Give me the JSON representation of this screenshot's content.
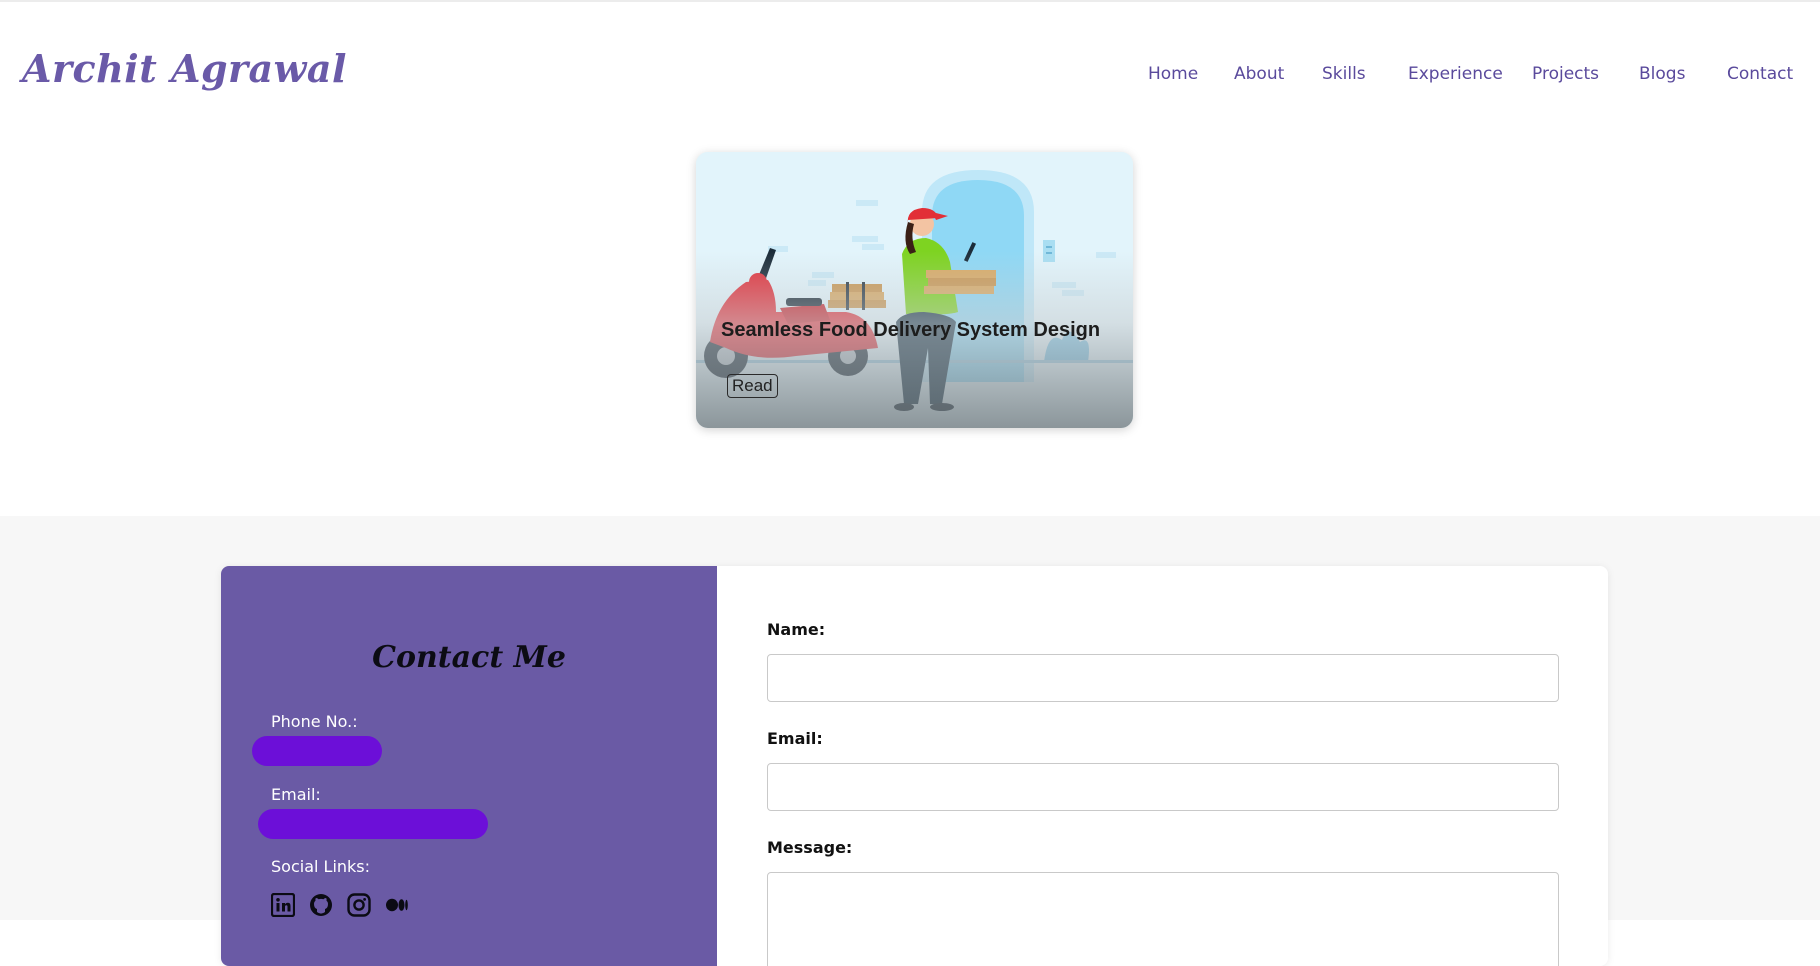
{
  "header": {
    "logo": "Archit Agrawal",
    "nav": [
      "Home",
      "About",
      "Skills",
      "Experience",
      "Projects",
      "Blogs",
      "Contact"
    ]
  },
  "blog": {
    "title": "Seamless Food Delivery System Design",
    "read_label": "Read",
    "image_icon": "food-delivery-illustration"
  },
  "contact": {
    "heading": "Contact Me",
    "phone_label": "Phone No.:",
    "email_label": "Email:",
    "social_label": "Social Links:",
    "social_icons": [
      "linkedin-icon",
      "github-icon",
      "instagram-icon",
      "medium-icon"
    ],
    "redaction_color": "#6c0fd8"
  },
  "form": {
    "name_label": "Name:",
    "email_label": "Email:",
    "message_label": "Message:"
  },
  "colors": {
    "accent": "#6a5aa8",
    "contact_panel": "#6a5aa5"
  }
}
